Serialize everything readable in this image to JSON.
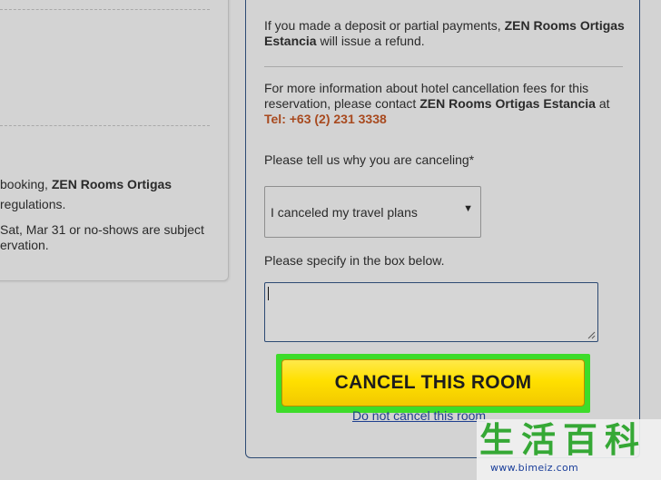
{
  "left_card": {
    "line1_prefix": "booking, ",
    "line1_bold": "ZEN Rooms Ortigas",
    "line2": "regulations.",
    "line3": "Sat, Mar 31 or no-shows are subject",
    "line4": "ervation."
  },
  "refund": {
    "prefix": "If you made a deposit or partial payments, ",
    "hotel": "ZEN Rooms Ortigas Estancia",
    "suffix": " will issue a refund."
  },
  "fees_info": {
    "prefix": "For more information about hotel cancellation fees for this reservation, please contact ",
    "hotel": "ZEN Rooms Ortigas Estancia",
    "suffix": " at",
    "phone": "Tel: +63 (2) 231 3338"
  },
  "reason": {
    "label": "Please tell us why you are canceling*",
    "selected": "I canceled my travel plans",
    "arrow": "▼"
  },
  "specify": {
    "label": "Please specify in the box below.",
    "value": ""
  },
  "actions": {
    "cancel_label": "CANCEL THIS ROOM",
    "keep_label": "Do not cancel this room"
  },
  "watermark": {
    "chars": "生活百科",
    "url": "www.bimeiz.com"
  },
  "colors": {
    "background": "#d3d3d3",
    "phone": "#a84a1f",
    "button_yellow": "#ffe000",
    "highlight_green": "#3ddc2a",
    "link_blue": "#1f3f8f",
    "panel_border": "#2d4a73"
  }
}
